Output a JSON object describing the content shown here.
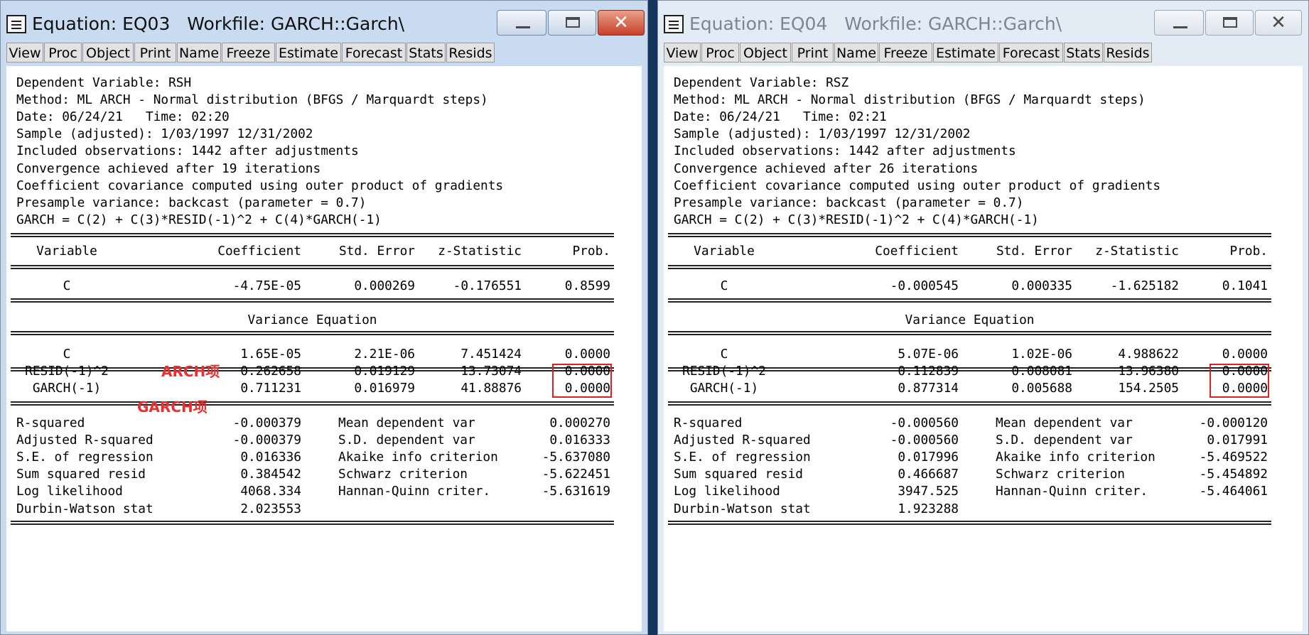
{
  "windows": [
    {
      "title": "Equation: EQ03   Workfile: GARCH::Garch\\",
      "toolbar": [
        "View",
        "Proc",
        "Object",
        "Print",
        "Name",
        "Freeze",
        "Estimate",
        "Forecast",
        "Stats",
        "Resids"
      ],
      "header_lines": [
        "Dependent Variable: RSH",
        "Method: ML ARCH - Normal distribution (BFGS / Marquardt steps)",
        "Date: 06/24/21   Time: 02:20",
        "Sample (adjusted): 1/03/1997 12/31/2002",
        "Included observations: 1442 after adjustments",
        "Convergence achieved after 19 iterations",
        "Coefficient covariance computed using outer product of gradients",
        "Presample variance: backcast (parameter = 0.7)",
        "GARCH = C(2) + C(3)*RESID(-1)^2 + C(4)*GARCH(-1)"
      ],
      "columns": [
        "Variable",
        "Coefficient",
        "Std. Error",
        "z-Statistic",
        "Prob."
      ],
      "mean_rows": [
        [
          "C",
          "-4.75E-05",
          "0.000269",
          "-0.176551",
          "0.8599"
        ]
      ],
      "variance_title": "Variance Equation",
      "variance_rows": [
        [
          "C",
          "1.65E-05",
          "2.21E-06",
          "7.451424",
          "0.0000"
        ],
        [
          "RESID(-1)^2",
          "0.262658",
          "0.019129",
          "13.73074",
          "0.0000"
        ],
        [
          "GARCH(-1)",
          "0.711231",
          "0.016979",
          "41.88876",
          "0.0000"
        ]
      ],
      "stats_rows": [
        [
          "R-squared",
          "-0.000379",
          "Mean dependent var",
          "0.000270"
        ],
        [
          "Adjusted R-squared",
          "-0.000379",
          "S.D. dependent var",
          "0.016333"
        ],
        [
          "S.E. of regression",
          "0.016336",
          "Akaike info criterion",
          "-5.637080"
        ],
        [
          "Sum squared resid",
          "0.384542",
          "Schwarz criterion",
          "-5.622451"
        ],
        [
          "Log likelihood",
          "4068.334",
          "Hannan-Quinn criter.",
          "-5.631619"
        ],
        [
          "Durbin-Watson stat",
          "2.023553",
          "",
          ""
        ]
      ],
      "annotations": {
        "arch": "ARCH项",
        "garch": "GARCH项"
      }
    },
    {
      "title": "Equation: EQ04   Workfile: GARCH::Garch\\",
      "toolbar": [
        "View",
        "Proc",
        "Object",
        "Print",
        "Name",
        "Freeze",
        "Estimate",
        "Forecast",
        "Stats",
        "Resids"
      ],
      "header_lines": [
        "Dependent Variable: RSZ",
        "Method: ML ARCH - Normal distribution (BFGS / Marquardt steps)",
        "Date: 06/24/21   Time: 02:21",
        "Sample (adjusted): 1/03/1997 12/31/2002",
        "Included observations: 1442 after adjustments",
        "Convergence achieved after 26 iterations",
        "Coefficient covariance computed using outer product of gradients",
        "Presample variance: backcast (parameter = 0.7)",
        "GARCH = C(2) + C(3)*RESID(-1)^2 + C(4)*GARCH(-1)"
      ],
      "columns": [
        "Variable",
        "Coefficient",
        "Std. Error",
        "z-Statistic",
        "Prob."
      ],
      "mean_rows": [
        [
          "C",
          "-0.000545",
          "0.000335",
          "-1.625182",
          "0.1041"
        ]
      ],
      "variance_title": "Variance Equation",
      "variance_rows": [
        [
          "C",
          "5.07E-06",
          "1.02E-06",
          "4.988622",
          "0.0000"
        ],
        [
          "RESID(-1)^2",
          "0.112839",
          "0.008081",
          "13.96380",
          "0.0000"
        ],
        [
          "GARCH(-1)",
          "0.877314",
          "0.005688",
          "154.2505",
          "0.0000"
        ]
      ],
      "stats_rows": [
        [
          "R-squared",
          "-0.000560",
          "Mean dependent var",
          "-0.000120"
        ],
        [
          "Adjusted R-squared",
          "-0.000560",
          "S.D. dependent var",
          "0.017991"
        ],
        [
          "S.E. of regression",
          "0.017996",
          "Akaike info criterion",
          "-5.469522"
        ],
        [
          "Sum squared resid",
          "0.466687",
          "Schwarz criterion",
          "-5.454892"
        ],
        [
          "Log likelihood",
          "3947.525",
          "Hannan-Quinn criter.",
          "-5.464061"
        ],
        [
          "Durbin-Watson stat",
          "1.923288",
          "",
          ""
        ]
      ]
    }
  ]
}
